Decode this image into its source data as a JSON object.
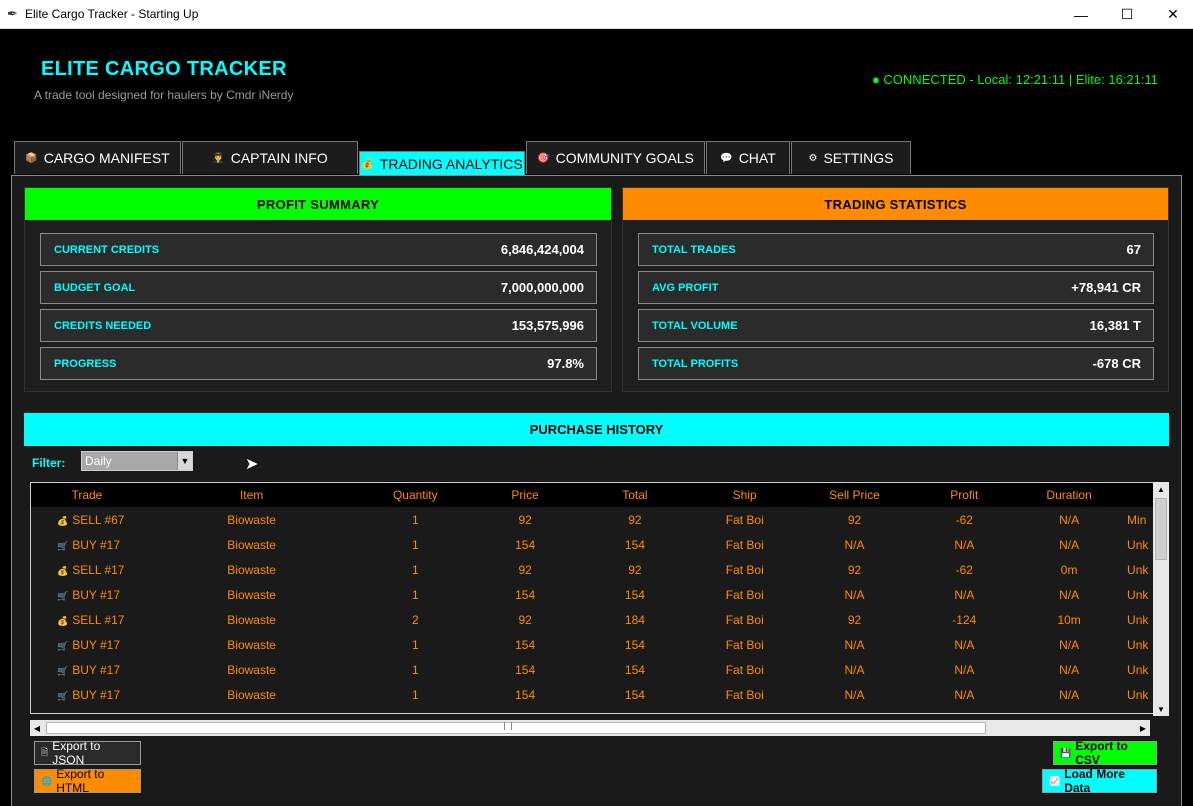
{
  "window": {
    "title": "Elite Cargo Tracker - Starting Up",
    "minimize_icon": "minimize-icon",
    "maximize_icon": "maximize-icon",
    "close_icon": "close-icon"
  },
  "header": {
    "brand": "ELITE CARGO TRACKER",
    "tagline": "A trade tool designed for haulers by Cmdr iNerdy",
    "status": "● CONNECTED - Local: 12:21:11 | Elite: 16:21:11"
  },
  "tabs": [
    {
      "label": "CARGO MANIFEST",
      "icon": "📦"
    },
    {
      "label": "CAPTAIN INFO",
      "icon": "👨‍✈️"
    },
    {
      "label": "TRADING ANALYTICS",
      "icon": "💰"
    },
    {
      "label": "COMMUNITY GOALS",
      "icon": "🎯"
    },
    {
      "label": "CHAT",
      "icon": "💬"
    },
    {
      "label": "SETTINGS",
      "icon": "⚙"
    }
  ],
  "profit_summary": {
    "title": "PROFIT SUMMARY",
    "rows": [
      {
        "label": "CURRENT CREDITS",
        "value": "6,846,424,004"
      },
      {
        "label": "BUDGET GOAL",
        "value": "7,000,000,000"
      },
      {
        "label": "CREDITS NEEDED",
        "value": "153,575,996"
      },
      {
        "label": "PROGRESS",
        "value": "97.8%"
      }
    ]
  },
  "trading_statistics": {
    "title": "TRADING STATISTICS",
    "rows": [
      {
        "label": "TOTAL TRADES",
        "value": "67"
      },
      {
        "label": "AVG PROFIT",
        "value": "+78,941 CR"
      },
      {
        "label": "TOTAL VOLUME",
        "value": "16,381 T"
      },
      {
        "label": "TOTAL PROFITS",
        "value": "-678 CR"
      }
    ]
  },
  "purchase_history": {
    "title": "PURCHASE HISTORY",
    "filter_label": "Filter:",
    "filter_value": "Daily",
    "columns": [
      "Trade",
      "Item",
      "Quantity",
      "Price",
      "Total",
      "Ship",
      "Sell Price",
      "Profit",
      "Duration",
      ""
    ],
    "rows": [
      {
        "icon": "💰",
        "cells": [
          "SELL #67",
          "Biowaste",
          "1",
          "92",
          "92",
          "Fat Boi",
          "92",
          "-62",
          "N/A",
          "Min"
        ]
      },
      {
        "icon": "🛒",
        "cells": [
          "BUY #17",
          "Biowaste",
          "1",
          "154",
          "154",
          "Fat Boi",
          "N/A",
          "N/A",
          "N/A",
          "Unk"
        ]
      },
      {
        "icon": "💰",
        "cells": [
          "SELL #17",
          "Biowaste",
          "1",
          "92",
          "92",
          "Fat Boi",
          "92",
          "-62",
          "0m",
          "Unk"
        ]
      },
      {
        "icon": "🛒",
        "cells": [
          "BUY #17",
          "Biowaste",
          "1",
          "154",
          "154",
          "Fat Boi",
          "N/A",
          "N/A",
          "N/A",
          "Unk"
        ]
      },
      {
        "icon": "💰",
        "cells": [
          "SELL #17",
          "Biowaste",
          "2",
          "92",
          "184",
          "Fat Boi",
          "92",
          "-124",
          "10m",
          "Unk"
        ]
      },
      {
        "icon": "🛒",
        "cells": [
          "BUY #17",
          "Biowaste",
          "1",
          "154",
          "154",
          "Fat Boi",
          "N/A",
          "N/A",
          "N/A",
          "Unk"
        ]
      },
      {
        "icon": "🛒",
        "cells": [
          "BUY #17",
          "Biowaste",
          "1",
          "154",
          "154",
          "Fat Boi",
          "N/A",
          "N/A",
          "N/A",
          "Unk"
        ]
      },
      {
        "icon": "🛒",
        "cells": [
          "BUY #17",
          "Biowaste",
          "1",
          "154",
          "154",
          "Fat Boi",
          "N/A",
          "N/A",
          "N/A",
          "Unk"
        ]
      }
    ]
  },
  "buttons": {
    "export_json": "Export to JSON",
    "export_html": "Export to HTML",
    "export_csv": "Export to CSV",
    "load_more": "Load More Data"
  },
  "colors": {
    "accent": "#00ffff",
    "profit_head": "#00ff00",
    "stats_head": "#ff8c00",
    "table_text": "#ff8c00",
    "status": "#00ff00"
  }
}
